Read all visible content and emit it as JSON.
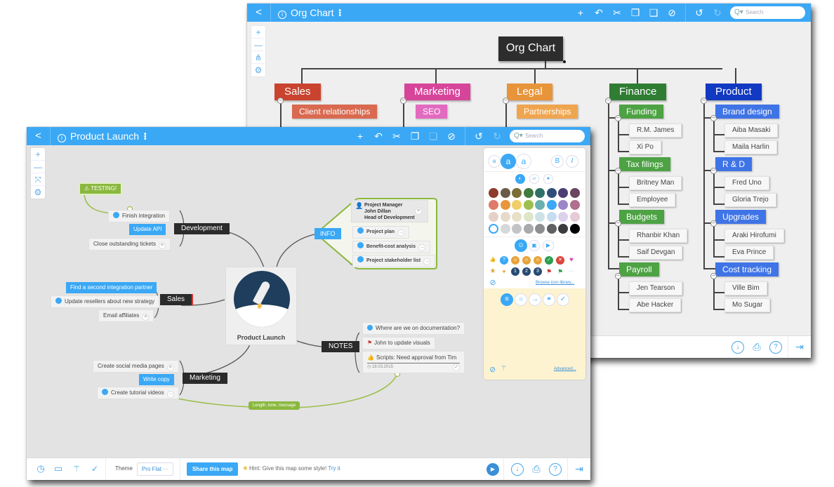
{
  "org_window": {
    "back_label": "<",
    "title": "Org Chart",
    "title_menu": "⁝",
    "toolbar": [
      "+",
      "↶",
      "✂",
      "❐",
      "❑",
      "⊘",
      "↺",
      "↻"
    ],
    "search_placeholder": "Search",
    "zoom_controls": [
      "+",
      "—",
      "⋔",
      "⚙"
    ],
    "root": "Org Chart",
    "departments": [
      {
        "name": "Sales",
        "color": "#c9432f",
        "sub": [
          {
            "name": "Client relationships",
            "color": "#d9694f",
            "people": []
          }
        ]
      },
      {
        "name": "Marketing",
        "color": "#d7459a",
        "sub": [
          {
            "name": "SEO",
            "color": "#e26bc0",
            "people": []
          }
        ]
      },
      {
        "name": "Legal",
        "color": "#e8943a",
        "sub": [
          {
            "name": "Partnerships",
            "color": "#efa550",
            "people": []
          }
        ]
      },
      {
        "name": "Finance",
        "color": "#2f7d33",
        "sub": [
          {
            "name": "Funding",
            "color": "#4da243",
            "people": [
              "R.M. James",
              "Xi Po"
            ]
          },
          {
            "name": "Tax filings",
            "color": "#4da243",
            "people": [
              "Britney Man",
              "Employee"
            ]
          },
          {
            "name": "Budgets",
            "color": "#4da243",
            "people": [
              "Rhanbir Khan",
              "Saif Devgan"
            ]
          },
          {
            "name": "Payroll",
            "color": "#4da243",
            "people": [
              "Jen Tearson",
              "Abe Hacker"
            ]
          }
        ]
      },
      {
        "name": "Product",
        "color": "#1139c2",
        "sub": [
          {
            "name": "Brand design",
            "color": "#3f74e6",
            "people": [
              "Aiba Masaki",
              "Maila Harlin"
            ]
          },
          {
            "name": "R & D",
            "color": "#3f74e6",
            "people": [
              "Fred Uno",
              "Gloria Trejo"
            ]
          },
          {
            "name": "Upgrades",
            "color": "#3f74e6",
            "people": [
              "Araki Hirofumi",
              "Eva Prince"
            ]
          },
          {
            "name": "Cost tracking",
            "color": "#3f74e6",
            "people": [
              "Ville Bim",
              "Mo Sugar"
            ]
          }
        ]
      }
    ],
    "bottom_icons": [
      "download-icon",
      "print-icon",
      "help-icon",
      "exit-icon"
    ]
  },
  "mm_window": {
    "back_label": "<",
    "title": "Product Launch",
    "title_menu": "⁝",
    "toolbar": [
      "+",
      "↶",
      "✂",
      "❐",
      "❑",
      "⊘",
      "↺",
      "↻"
    ],
    "search_placeholder": "Search",
    "zoom_controls": [
      "+",
      "—",
      "⤧",
      "⚙"
    ],
    "center": "Product Launch",
    "testing": "⚠ TESTING!",
    "development": {
      "label": "Development",
      "items": [
        "Finish integration",
        "Update API",
        "Close outstanding tickets"
      ]
    },
    "sales": {
      "label": "Sales",
      "items": [
        "Find a second integration partner",
        "Update resellers about new strategy",
        "Email affiliates"
      ]
    },
    "marketing": {
      "label": "Marketing",
      "items": [
        "Create social media pages",
        "Write copy",
        "Create tutorial videos"
      ]
    },
    "info": {
      "label": "INFO",
      "contact": [
        "Project Manager",
        "John Dillan",
        "Head of Development"
      ],
      "items": [
        "Project plan",
        "Benefit-cost analysis",
        "Project stakeholder list"
      ]
    },
    "notes": {
      "label": "NOTES",
      "items": [
        "Where are we on documentation?",
        "John to update visuals",
        "Scripts: Need approval from Tim"
      ],
      "date": "18.03.2015"
    },
    "relation_label": "Length, tone, message",
    "panel": {
      "font_sizes": [
        "a",
        "a",
        "a"
      ],
      "bold": "B",
      "italic": "I",
      "swatches": [
        "#8e3b2c",
        "#6b5a45",
        "#7a6d38",
        "#3f7a3e",
        "#2f7068",
        "#2f4f7a",
        "#4d3d75",
        "#6b4560",
        "#e07a6a",
        "#e8963e",
        "#f0cf6a",
        "#9dbf4f",
        "#6ab0b0",
        "#3aa8f5",
        "#9b86c8",
        "#b0708e",
        "#e6d0c8",
        "#e6dacb",
        "#e6e0c8",
        "#dde6c8",
        "#cce2e6",
        "#c8dcef",
        "#dcd2ec",
        "#e6cad8",
        "#ffffff",
        "#d6d8da",
        "#c2c4c6",
        "#a8aaac",
        "#8c8e90",
        "#5e6062",
        "#3a3c3e",
        "#000000"
      ],
      "browse_link": "Browse icon library...",
      "advanced_link": "Advanced..."
    },
    "bottom": {
      "theme_label": "Theme",
      "theme_value": "Pro Flat",
      "theme_more": "···",
      "share_button": "Share this map",
      "hint": "Hint: Give this map some style!",
      "hint_link": "Try it"
    }
  }
}
